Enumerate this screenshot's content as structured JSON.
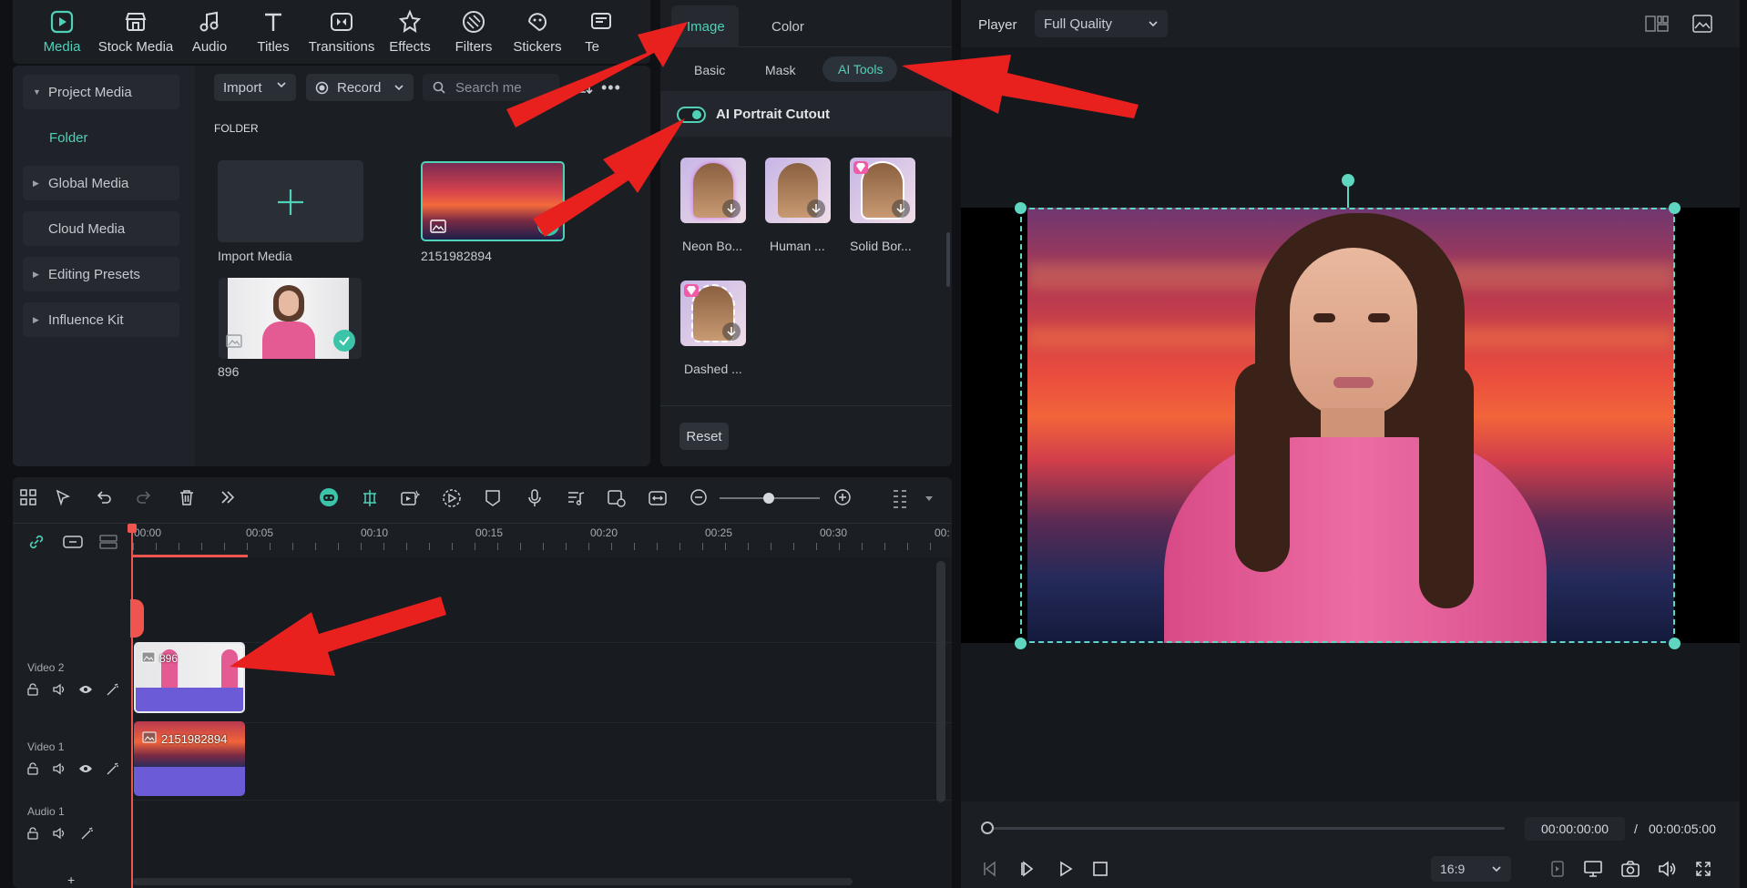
{
  "toolbar": {
    "items": [
      {
        "label": "Media",
        "icon": "media-icon"
      },
      {
        "label": "Stock Media",
        "icon": "stock-media-icon"
      },
      {
        "label": "Audio",
        "icon": "audio-icon"
      },
      {
        "label": "Titles",
        "icon": "titles-icon"
      },
      {
        "label": "Transitions",
        "icon": "transitions-icon"
      },
      {
        "label": "Effects",
        "icon": "effects-icon"
      },
      {
        "label": "Filters",
        "icon": "filters-icon"
      },
      {
        "label": "Stickers",
        "icon": "stickers-icon"
      },
      {
        "label": "Te",
        "icon": "templates-icon"
      }
    ]
  },
  "sidebar": {
    "items": [
      "Project Media",
      "Folder",
      "Global Media",
      "Cloud Media",
      "Editing Presets",
      "Influence Kit"
    ]
  },
  "media": {
    "import_label": "Import",
    "record_label": "Record",
    "search_placeholder": "Search me",
    "folder_heading": "FOLDER",
    "import_media_label": "Import Media",
    "items": [
      {
        "name": "2151982894"
      },
      {
        "name": "896"
      }
    ]
  },
  "properties": {
    "tabs": [
      "Image",
      "Color"
    ],
    "subtabs": [
      "Basic",
      "Mask",
      "AI Tools"
    ],
    "cutout_label": "AI Portrait Cutout",
    "presets": [
      "Neon Bo...",
      "Human ...",
      "Solid Bor...",
      "Dashed ..."
    ],
    "reset_label": "Reset"
  },
  "player": {
    "label": "Player",
    "quality": "Full Quality",
    "current_time": "00:00:00:00",
    "separator": "/",
    "total_time": "00:00:05:00",
    "aspect": "16:9"
  },
  "timeline": {
    "ruler": [
      "00:00",
      "00:05",
      "00:10",
      "00:15",
      "00:20",
      "00:25",
      "00:30",
      "00:"
    ],
    "tracks": [
      {
        "name": "Video 2",
        "clip": "896"
      },
      {
        "name": "Video 1",
        "clip": "2151982894"
      },
      {
        "name": "Audio 1",
        "clip": ""
      }
    ]
  },
  "colors": {
    "accent": "#4fd1b8",
    "playhead": "#f0544f",
    "clip": "#6c5bd6",
    "arrow": "#e8201e"
  }
}
